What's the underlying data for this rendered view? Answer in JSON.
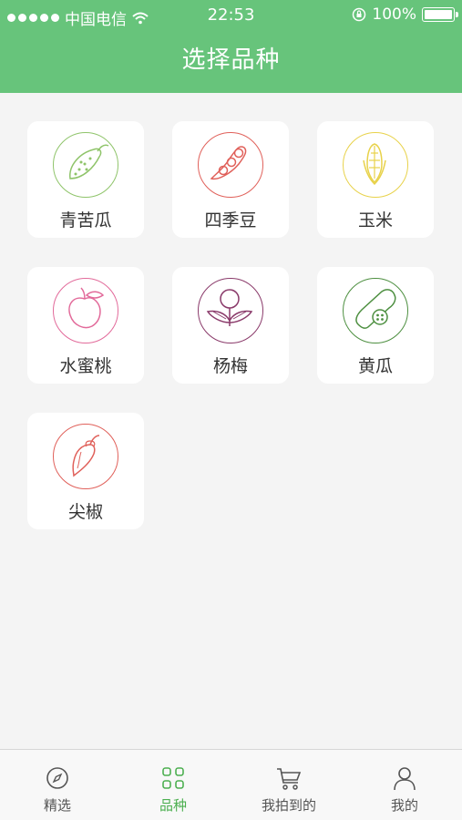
{
  "status": {
    "carrier": "中国电信",
    "time": "22:53",
    "battery": "100%"
  },
  "header": {
    "title": "选择品种"
  },
  "varieties": [
    {
      "label": "青苦瓜",
      "icon": "bitter-melon-icon",
      "color": "#8fc46a"
    },
    {
      "label": "四季豆",
      "icon": "bean-icon",
      "color": "#e0605a"
    },
    {
      "label": "玉米",
      "icon": "corn-icon",
      "color": "#e8d24a"
    },
    {
      "label": "水蜜桃",
      "icon": "peach-icon",
      "color": "#e26a9a"
    },
    {
      "label": "杨梅",
      "icon": "bayberry-icon",
      "color": "#8a3a6a"
    },
    {
      "label": "黄瓜",
      "icon": "cucumber-icon",
      "color": "#4d8f40"
    },
    {
      "label": "尖椒",
      "icon": "chili-pepper-icon",
      "color": "#e0605a"
    }
  ],
  "tabs": [
    {
      "label": "精选",
      "icon": "compass-icon",
      "active": false
    },
    {
      "label": "品种",
      "icon": "grid-icon",
      "active": true
    },
    {
      "label": "我拍到的",
      "icon": "cart-icon",
      "active": false
    },
    {
      "label": "我的",
      "icon": "user-icon",
      "active": false
    }
  ],
  "colors": {
    "accent": "#67c47b",
    "active_tab": "#4caf50"
  }
}
